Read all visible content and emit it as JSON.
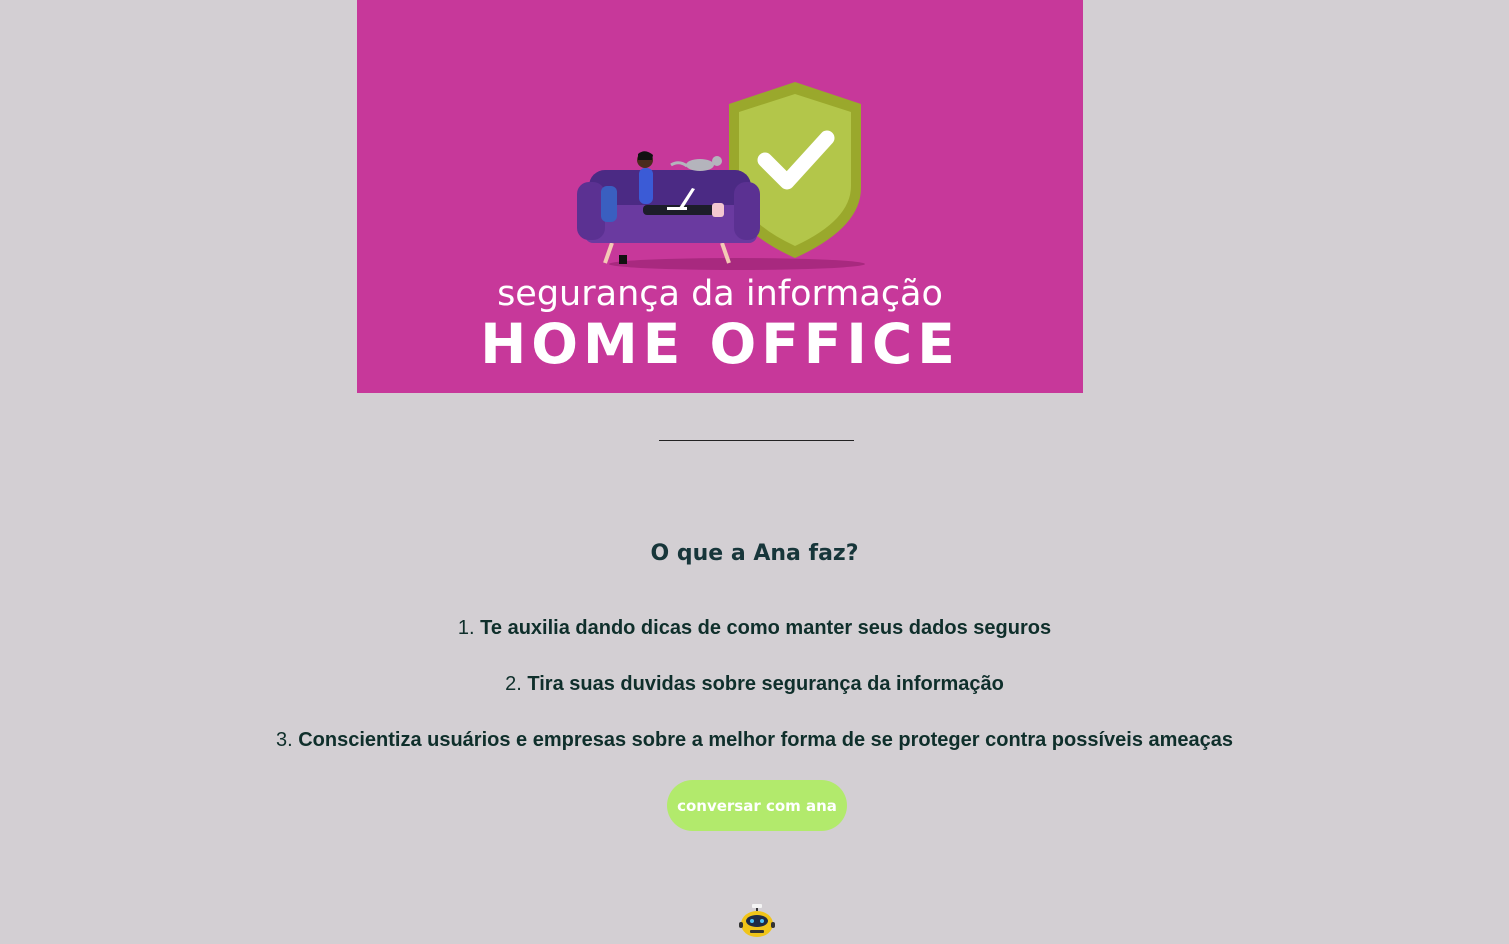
{
  "banner": {
    "subtitle": "segurança da informação",
    "title": "HOME OFFICE",
    "background_color": "#c7389a",
    "illustration": "person-on-sofa-with-laptop-and-shield-check-icon"
  },
  "section": {
    "heading": "O que a Ana faz?",
    "items": [
      {
        "number": "1.",
        "text": "Te auxilia dando dicas de como manter seus dados seguros"
      },
      {
        "number": "2.",
        "text": "Tira suas duvidas sobre segurança da informação"
      },
      {
        "number": "3.",
        "text": "Conscientiza usuários e empresas sobre a melhor forma de se proteger contra possíveis ameaças"
      }
    ]
  },
  "cta": {
    "label": "conversar com ana",
    "color": "#b2ea6c"
  },
  "chatbot": {
    "icon": "robot-icon"
  }
}
